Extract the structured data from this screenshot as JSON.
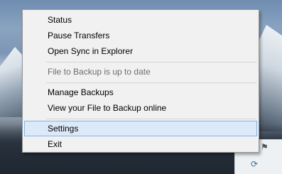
{
  "menu": {
    "items": [
      {
        "label": "Status",
        "enabled": true
      },
      {
        "label": "Pause Transfers",
        "enabled": true
      },
      {
        "label": "Open Sync in Explorer",
        "enabled": true
      },
      {
        "label": "File to Backup is up to date",
        "enabled": false
      },
      {
        "label": "Manage Backups",
        "enabled": true
      },
      {
        "label": "View your File to Backup online",
        "enabled": true
      },
      {
        "label": "Settings",
        "enabled": true,
        "highlighted": true
      },
      {
        "label": "Exit",
        "enabled": true
      }
    ]
  },
  "colors": {
    "menu_bg": "#f1f1f1",
    "menu_border": "#979797",
    "highlight_bg": "#dbe9f8",
    "highlight_border": "#7eb4ea",
    "disabled_text": "#6d6d6d"
  },
  "tray": {
    "icons": [
      "network-icon",
      "flag-icon",
      "sync-icon"
    ]
  }
}
